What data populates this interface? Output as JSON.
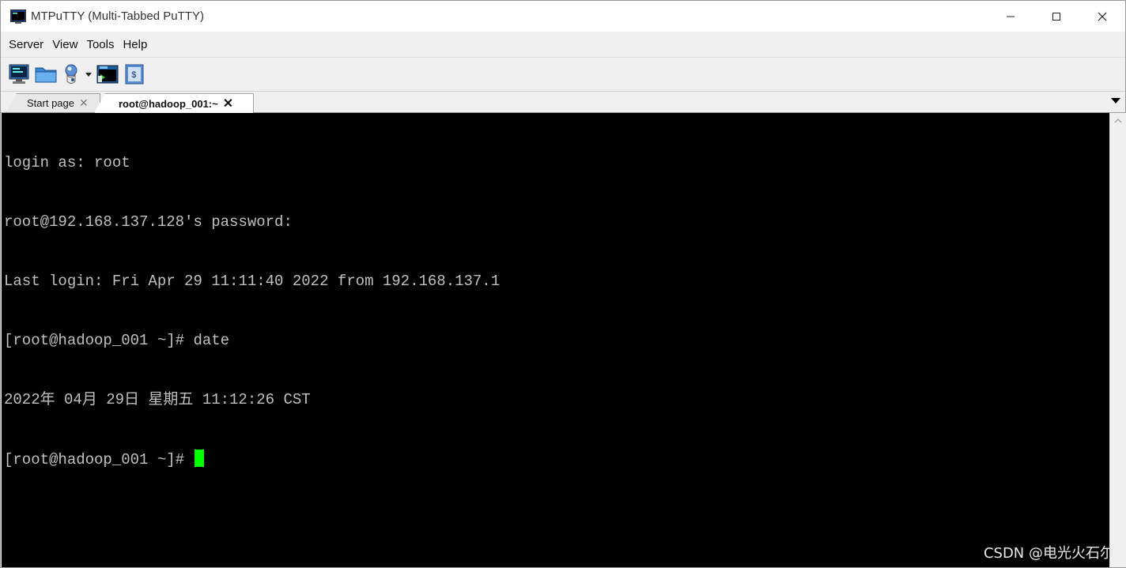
{
  "window": {
    "title": "MTPuTTY (Multi-Tabbed PuTTY)",
    "controls": {
      "minimize": "—",
      "maximize": "☐",
      "close": "✕"
    }
  },
  "menubar": {
    "items": [
      {
        "label": "Server"
      },
      {
        "label": "View"
      },
      {
        "label": "Tools"
      },
      {
        "label": "Help"
      }
    ]
  },
  "toolbar": {
    "buttons": [
      {
        "icon": "new-session-icon"
      },
      {
        "icon": "open-folder-icon"
      },
      {
        "icon": "connect-icon"
      },
      {
        "icon": "terminal-window-icon"
      },
      {
        "icon": "script-icon"
      }
    ]
  },
  "tabs": [
    {
      "label": "Start page",
      "close": "✕",
      "active": false
    },
    {
      "label": "root@hadoop_001:~",
      "close": "✕",
      "active": true
    }
  ],
  "terminal": {
    "lines": [
      "login as: root",
      "root@192.168.137.128's password:",
      "Last login: Fri Apr 29 11:11:40 2022 from 192.168.137.1",
      "[root@hadoop_001 ~]# date",
      "2022年 04月 29日 星期五 11:12:26 CST",
      "[root@hadoop_001 ~]# "
    ],
    "cursor_color": "#00ff00",
    "background": "#000000",
    "foreground": "#c0c0c0"
  },
  "watermark": "CSDN @电光火石尔"
}
